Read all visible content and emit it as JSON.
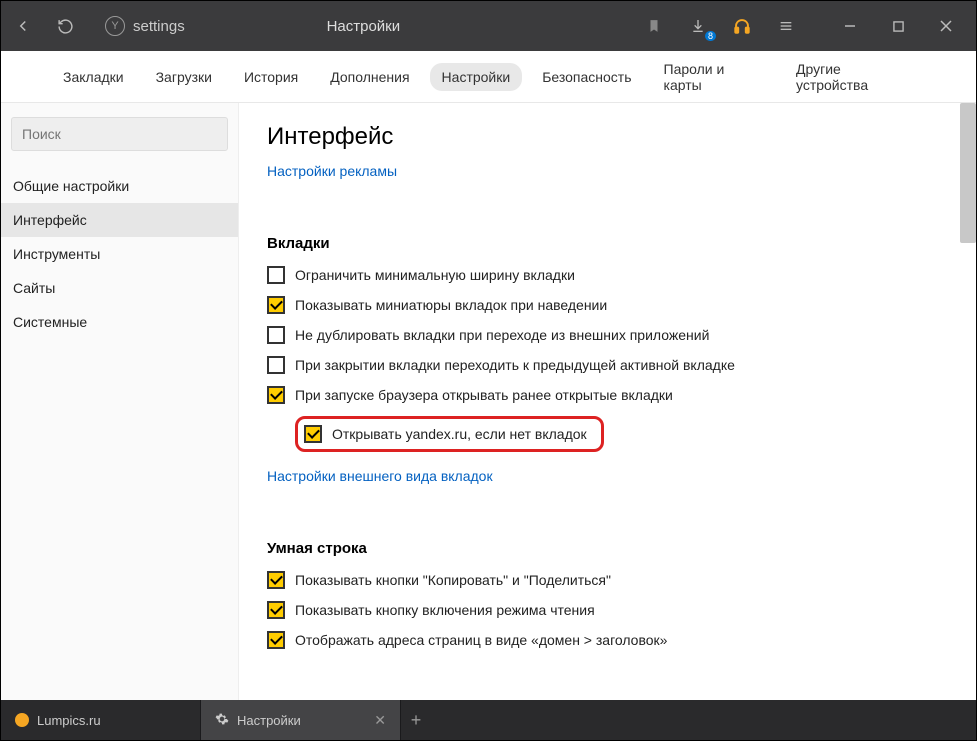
{
  "titlebar": {
    "address": "settings",
    "title": "Настройки",
    "badge": "8"
  },
  "topnav": {
    "items": [
      "Закладки",
      "Загрузки",
      "История",
      "Дополнения",
      "Настройки",
      "Безопасность",
      "Пароли и карты",
      "Другие устройства"
    ],
    "active_index": 4
  },
  "sidebar": {
    "search_placeholder": "Поиск",
    "items": [
      "Общие настройки",
      "Интерфейс",
      "Инструменты",
      "Сайты",
      "Системные"
    ],
    "active_index": 1
  },
  "content": {
    "heading": "Интерфейс",
    "ads_link": "Настройки рекламы",
    "section_tabs": {
      "title": "Вкладки",
      "options": [
        {
          "checked": false,
          "label": "Ограничить минимальную ширину вкладки"
        },
        {
          "checked": true,
          "label": "Показывать миниатюры вкладок при наведении"
        },
        {
          "checked": false,
          "label": "Не дублировать вкладки при переходе из внешних приложений"
        },
        {
          "checked": false,
          "label": "При закрытии вкладки переходить к предыдущей активной вкладке"
        },
        {
          "checked": true,
          "label": "При запуске браузера открывать ранее открытые вкладки"
        },
        {
          "checked": true,
          "label": "Открывать yandex.ru, если нет вкладок",
          "indent": true,
          "highlighted": true
        }
      ],
      "appearance_link": "Настройки внешнего вида вкладок"
    },
    "section_smartline": {
      "title": "Умная строка",
      "options": [
        {
          "checked": true,
          "label": "Показывать кнопки \"Копировать\" и \"Поделиться\""
        },
        {
          "checked": true,
          "label": "Показывать кнопку включения режима чтения"
        },
        {
          "checked": true,
          "label": "Отображать адреса страниц в виде «домен > заголовок»"
        }
      ]
    }
  },
  "tabs": {
    "items": [
      {
        "label": "Lumpics.ru",
        "color": "#f5a623"
      },
      {
        "label": "Настройки",
        "color": "#ccc",
        "active": true
      }
    ]
  }
}
